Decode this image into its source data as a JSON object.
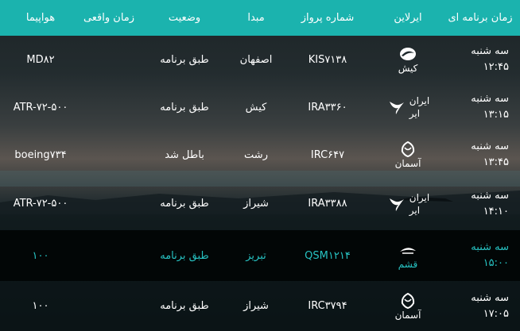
{
  "header": {
    "scheduled": "زمان برنامه ای",
    "airline": "ایرلاین",
    "flight_no": "شماره پرواز",
    "origin": "مبدا",
    "status": "وضعیت",
    "actual": "زمان واقعی",
    "aircraft": "هواپیما"
  },
  "colors": {
    "header_bg": "#1bb3ae",
    "highlight_text": "#27c2c2",
    "highlight_row": "#020606"
  },
  "rows": [
    {
      "day": "سه شنبه",
      "time": "۱۲:۴۵",
      "airline": "کیش",
      "airline_icon": "kish-air-logo-icon",
      "flight": "KIS۷۱۳۸",
      "origin": "اصفهان",
      "status": "طبق برنامه",
      "actual": "",
      "aircraft": "MD۸۲"
    },
    {
      "day": "سه شنبه",
      "time": "۱۳:۱۵",
      "airline_line1": "ایران",
      "airline_line2": "ایر",
      "airline_icon": "iran-air-logo-icon",
      "flight": "IRA۳۳۶۰",
      "origin": "کیش",
      "status": "طبق برنامه",
      "actual": "",
      "aircraft": "ATR-۷۲-۵۰۰"
    },
    {
      "day": "سه شنبه",
      "time": "۱۳:۴۵",
      "airline": "آسمان",
      "airline_icon": "aseman-logo-icon",
      "flight": "IRC۶۴۷",
      "origin": "رشت",
      "status": "باطل شد",
      "actual": "",
      "aircraft": "boeing۷۳۴"
    },
    {
      "day": "سه شنبه",
      "time": "۱۴:۱۰",
      "airline_line1": "ایران",
      "airline_line2": "ایر",
      "airline_icon": "iran-air-logo-icon",
      "flight": "IRA۳۳۸۸",
      "origin": "شیراز",
      "status": "طبق برنامه",
      "actual": "",
      "aircraft": "ATR-۷۲-۵۰۰"
    },
    {
      "day": "سه شنبه",
      "time": "۱۵:۰۰",
      "airline": "قشم",
      "airline_icon": "qeshm-air-logo-icon",
      "flight": "QSM۱۲۱۴",
      "origin": "تبریز",
      "status": "طبق برنامه",
      "actual": "",
      "aircraft": "۱۰۰",
      "highlighted": true
    },
    {
      "day": "سه شنبه",
      "time": "۱۷:۰۵",
      "airline": "آسمان",
      "airline_icon": "aseman-logo-icon",
      "flight": "IRC۳۷۹۴",
      "origin": "شیراز",
      "status": "طبق برنامه",
      "actual": "",
      "aircraft": "۱۰۰"
    }
  ]
}
